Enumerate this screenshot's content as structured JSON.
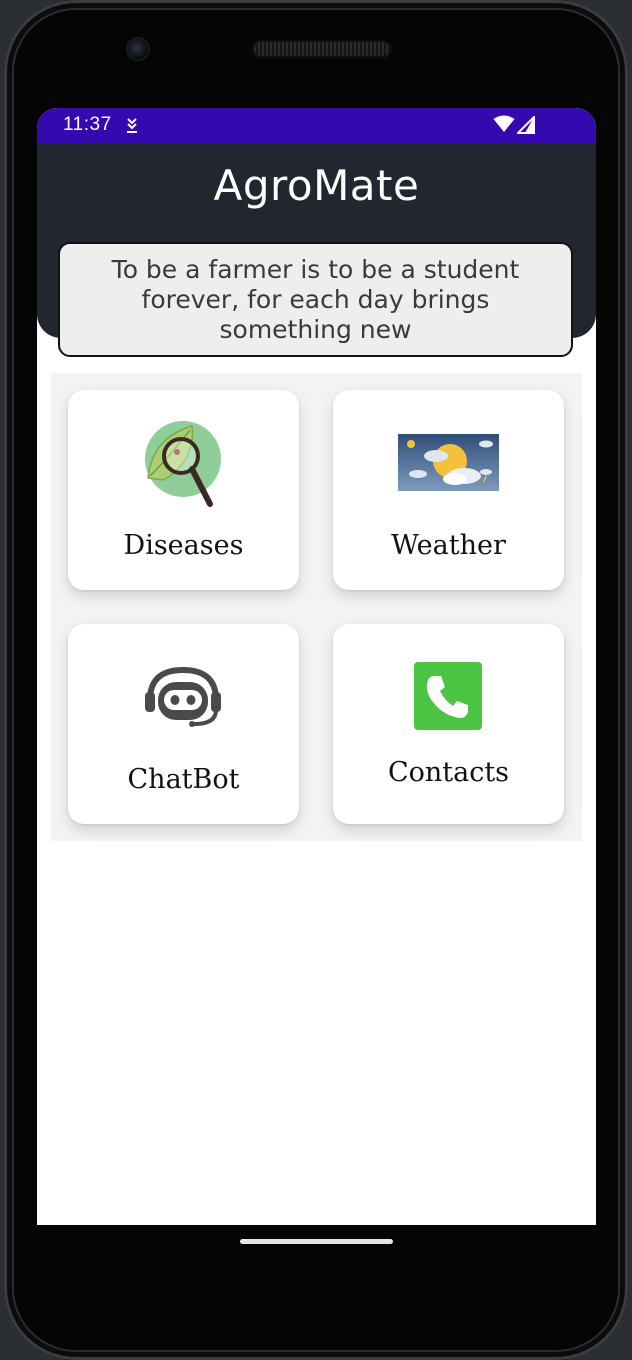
{
  "status_bar": {
    "time": "11:37",
    "bg_color": "#3508b0"
  },
  "app": {
    "title": "AgroMate",
    "quote": "To be a farmer is to be a student forever, for each day brings something new"
  },
  "menu": {
    "items": [
      {
        "label": "Diseases",
        "icon": "leaf-magnifier-icon"
      },
      {
        "label": "Weather",
        "icon": "weather-icon"
      },
      {
        "label": "ChatBot",
        "icon": "chatbot-icon"
      },
      {
        "label": "Contacts",
        "icon": "phone-icon",
        "icon_color": "#4cc443"
      }
    ]
  },
  "colors": {
    "header": "#22262f",
    "quote_bg": "#eeeeee"
  }
}
